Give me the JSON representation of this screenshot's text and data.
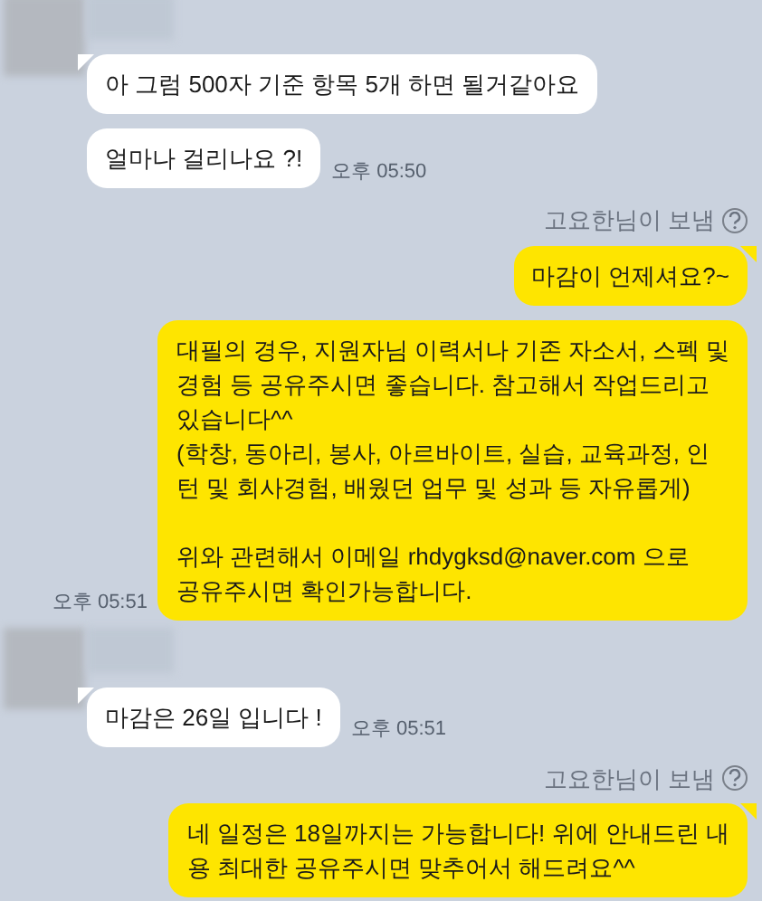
{
  "groups": [
    {
      "kind": "incoming",
      "messages": [
        {
          "tail": true,
          "paragraphs": [
            [
              "아 그럼 500자 기준 항목 5개 하면 될거같아요"
            ]
          ]
        },
        {
          "tail": false,
          "paragraphs": [
            [
              "얼마나 걸리나요 ?!"
            ]
          ],
          "time": "오후 05:50"
        }
      ]
    },
    {
      "kind": "outgoing",
      "sender_label": "고요한님이 보냄",
      "messages": [
        {
          "tail": true,
          "paragraphs": [
            [
              "마감이 언제셔요?~"
            ]
          ]
        },
        {
          "tail": false,
          "paragraphs": [
            [
              "대필의 경우, 지원자님 이력서나 기존 자소서, 스펙 및",
              "경험 등 공유주시면 좋습니다. 참고해서 작업드리고",
              "있습니다^^",
              "(학창, 동아리, 봉사, 아르바이트, 실습, 교육과정, 인",
              "턴 및 회사경험, 배웠던 업무 및 성과 등 자유롭게)"
            ],
            [
              "위와 관련해서 이메일 rhdygksd@naver.com 으로",
              "공유주시면 확인가능합니다."
            ]
          ],
          "time": "오후 05:51"
        }
      ]
    },
    {
      "kind": "incoming",
      "messages": [
        {
          "tail": true,
          "paragraphs": [
            [
              "마감은 26일 입니다 !"
            ]
          ],
          "time": "오후 05:51"
        }
      ]
    },
    {
      "kind": "outgoing",
      "sender_label": "고요한님이 보냄",
      "messages": [
        {
          "tail": true,
          "paragraphs": [
            [
              "네 일정은 18일까지는 가능합니다! 위에 안내드린 내",
              "용 최대한 공유주시면 맞추어서 해드려요^^"
            ]
          ]
        }
      ]
    }
  ]
}
